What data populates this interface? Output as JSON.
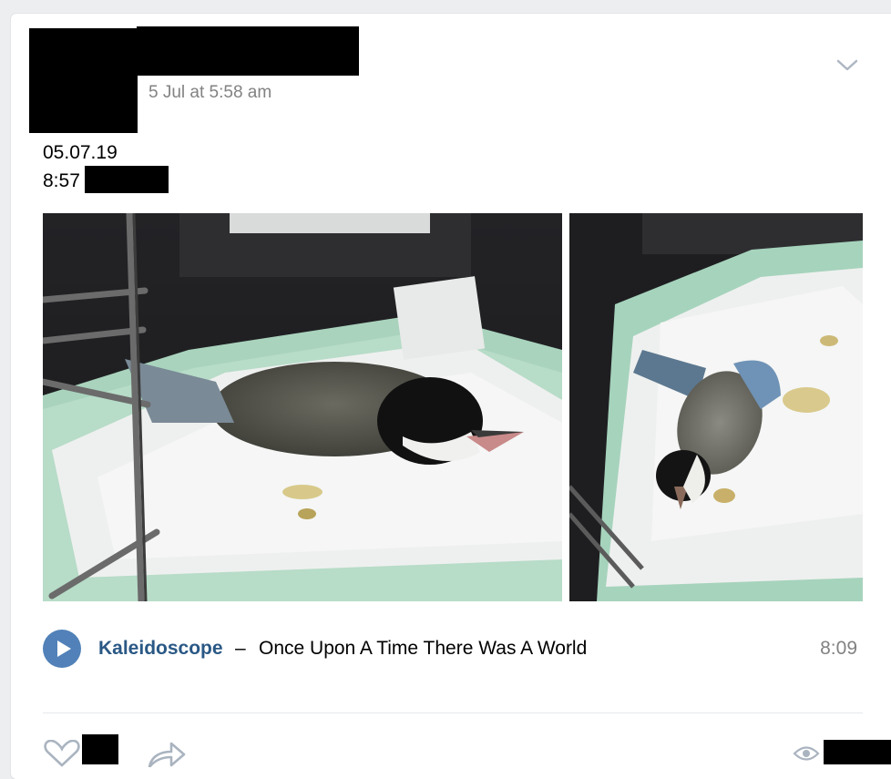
{
  "post": {
    "timestamp": "5 Jul at 5:58 am",
    "text_line1": "05.07.19",
    "text_line2": "8:57"
  },
  "attachments": {
    "photos": [
      {
        "alt": "bird lying on paper towel in cage"
      },
      {
        "alt": "bird lying on its side on paper towel"
      }
    ],
    "audio": {
      "artist": "Kaleidoscope",
      "separator": "–",
      "title": "Once Upon A Time There Was A World",
      "duration": "8:09"
    }
  },
  "actions": {
    "like_icon": "heart-icon",
    "share_icon": "share-icon",
    "views_icon": "eye-icon"
  },
  "colors": {
    "link": "#2a5885",
    "accent": "#5181b8",
    "muted": "#828282",
    "page_bg": "#edeef0"
  }
}
